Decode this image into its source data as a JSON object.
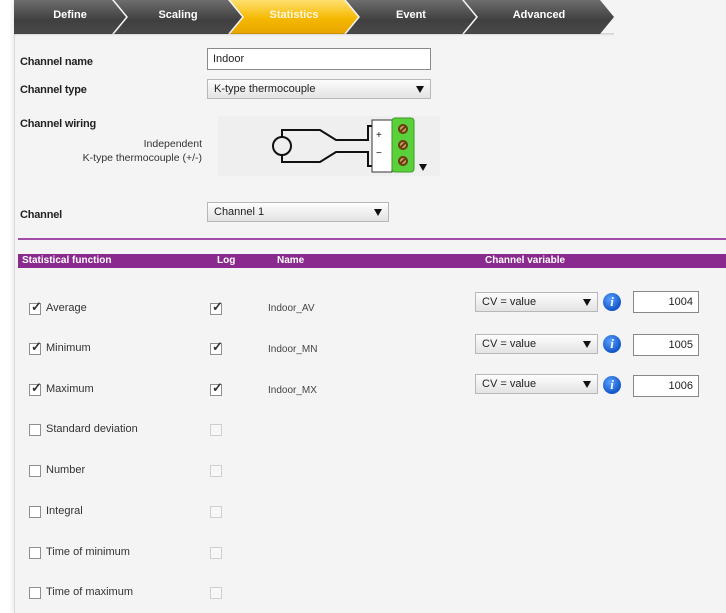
{
  "tabs": [
    "Define",
    "Scaling",
    "Statistics",
    "Event",
    "Advanced"
  ],
  "form": {
    "channel_name_label": "Channel name",
    "channel_name_value": "Indoor",
    "channel_type_label": "Channel type",
    "channel_type_value": "K-type thermocouple",
    "channel_wiring_label": "Channel wiring",
    "wiring_line1": "Independent",
    "wiring_line2": "K-type thermocouple (+/-)",
    "channel_label": "Channel",
    "channel_value": "Channel 1"
  },
  "table": {
    "headers": {
      "function": "Statistical function",
      "log": "Log",
      "name": "Name",
      "variable": "Channel variable"
    },
    "rows": [
      {
        "label": "Average",
        "checked": true,
        "log": true,
        "name": "Indoor_AV",
        "cv": "CV = value",
        "number": "1004"
      },
      {
        "label": "Minimum",
        "checked": true,
        "log": true,
        "name": "Indoor_MN",
        "cv": "CV = value",
        "number": "1005"
      },
      {
        "label": "Maximum",
        "checked": true,
        "log": true,
        "name": "Indoor_MX",
        "cv": "CV = value",
        "number": "1006"
      },
      {
        "label": "Standard deviation",
        "checked": false,
        "log": false
      },
      {
        "label": "Number",
        "checked": false,
        "log": false
      },
      {
        "label": "Integral",
        "checked": false,
        "log": false
      },
      {
        "label": "Time of minimum",
        "checked": false,
        "log": false
      },
      {
        "label": "Time of maximum",
        "checked": false,
        "log": false
      }
    ]
  },
  "colors": {
    "active_tab": "#f5b800",
    "tab_dark": "#4a4a4a",
    "header_bar": "#8b2a8e",
    "info_icon": "#1257c8",
    "terminal_green": "#5ad03a"
  },
  "icons": {
    "info": "info-icon",
    "dropdown": "chevron-down-icon",
    "check": "checkmark-icon"
  }
}
